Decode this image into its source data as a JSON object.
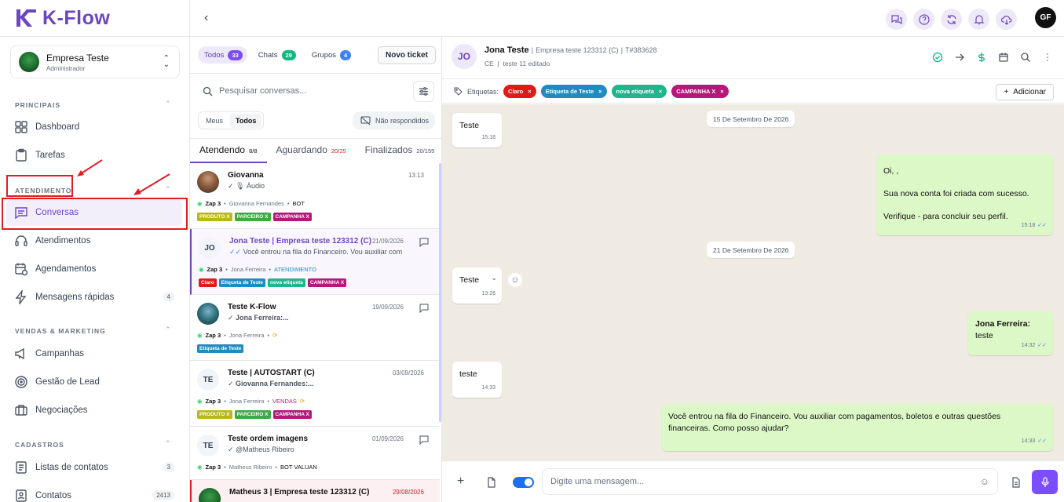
{
  "brand": {
    "name": "K-Flow",
    "color": "#6b46c1"
  },
  "company": {
    "name": "Empresa Teste",
    "role": "Administrador"
  },
  "sidebar": {
    "sections": [
      {
        "title": "PRINCIPAIS",
        "items": [
          {
            "label": "Dashboard",
            "icon": "dashboard-icon"
          },
          {
            "label": "Tarefas",
            "icon": "clipboard-icon"
          }
        ]
      },
      {
        "title": "ATENDIMENTO",
        "items": [
          {
            "label": "Conversas",
            "icon": "chat-icon",
            "active": true
          },
          {
            "label": "Atendimentos",
            "icon": "headset-icon"
          },
          {
            "label": "Agendamentos",
            "icon": "calendar-clock-icon"
          },
          {
            "label": "Mensagens rápidas",
            "icon": "bolt-icon",
            "badge": "4"
          }
        ]
      },
      {
        "title": "VENDAS & MARKETING",
        "items": [
          {
            "label": "Campanhas",
            "icon": "megaphone-icon"
          },
          {
            "label": "Gestão de Lead",
            "icon": "target-icon"
          },
          {
            "label": "Negociações",
            "icon": "briefcase-icon"
          }
        ]
      },
      {
        "title": "CADASTROS",
        "items": [
          {
            "label": "Listas de contatos",
            "icon": "list-icon",
            "badge": "3"
          },
          {
            "label": "Contatos",
            "icon": "contact-icon",
            "badge": "2413"
          }
        ]
      }
    ]
  },
  "topbar": {
    "user_initials": "GF"
  },
  "filters": {
    "tabs": [
      {
        "label": "Todos",
        "count": "33",
        "color": "#7c4dff"
      },
      {
        "label": "Chats",
        "count": "29",
        "color": "#10b981"
      },
      {
        "label": "Grupos",
        "count": "4",
        "color": "#3b82f6"
      }
    ],
    "new_ticket": "Novo ticket",
    "search_placeholder": "Pesquisar conversas...",
    "seg": [
      "Meus",
      "Todos"
    ],
    "unanswered": "Não respondidos",
    "status_tabs": [
      {
        "label": "Atendendo",
        "count": "8/8"
      },
      {
        "label": "Aguardando",
        "count": "20/25"
      },
      {
        "label": "Finalizados",
        "count": "20/155"
      }
    ]
  },
  "conversations": [
    {
      "initials": "",
      "name": "Giovanna",
      "date": "13:13",
      "msg": "Áudio",
      "meta_zap": "Zap 3",
      "meta_agent": "Giovanna Fernandes",
      "meta_status": "BOT",
      "tags": [
        [
          "PRODUTO X",
          "#b8b81a"
        ],
        [
          "PARCEIRO X",
          "#3fa847"
        ],
        [
          "CAMPANHA X",
          "#b5177a"
        ]
      ]
    },
    {
      "initials": "JO",
      "name": "Jona Teste | Empresa teste 123312 (C)",
      "date": "21/09/2026",
      "msg": "Você entrou na fila do Financeiro. Vou auxiliar com p...",
      "meta_zap": "Zap 3",
      "meta_agent": "Jona Ferreira",
      "meta_status": "ATENDIMENTO",
      "tags": [
        [
          "Claro",
          "#e01919"
        ],
        [
          "Etiqueta de Teste",
          "#1f8bbf"
        ],
        [
          "nova etiqueta",
          "#21b58c"
        ],
        [
          "CAMPANHA X",
          "#b5177a"
        ]
      ]
    },
    {
      "initials": "",
      "name": "Teste K-Flow",
      "date": "19/09/2026",
      "msg": "Jona Ferreira:...",
      "meta_zap": "Zap 3",
      "meta_agent": "Jona Ferreira",
      "meta_status": "",
      "tags": [
        [
          "Etiqueta de Teste",
          "#1f8bbf"
        ]
      ]
    },
    {
      "initials": "TE",
      "name": "Teste | AUTOSTART (C)",
      "date": "03/09/2026",
      "msg": "Giovanna Fernandes:...",
      "meta_zap": "Zap 3",
      "meta_agent": "Jona Ferreira",
      "meta_status": "VENDAS",
      "tags": [
        [
          "PRODUTO X",
          "#b8b81a"
        ],
        [
          "PARCEIRO X",
          "#3fa847"
        ],
        [
          "CAMPANHA X",
          "#b5177a"
        ]
      ]
    },
    {
      "initials": "TE",
      "name": "Teste ordem imagens",
      "date": "01/09/2026",
      "msg": "@Matheus Ribeiro",
      "meta_zap": "Zap 3",
      "meta_agent": "Matheus Ribeiro",
      "meta_status": "BOT VALUAN",
      "tags": []
    },
    {
      "initials": "",
      "name": "Matheus 3 | Empresa teste 123312 (C)",
      "date": "29/08/2026",
      "msg": "",
      "meta_zap": "",
      "meta_agent": "",
      "meta_status": "",
      "tags": []
    }
  ],
  "chat": {
    "initials": "JO",
    "name": "Jona Teste",
    "company": "Empresa teste 123312 (C)",
    "ticket": "T#383628",
    "sub1": "CE",
    "sub2": "teste 11 editado",
    "labels_title": "Etiquetas:",
    "labels": [
      [
        "Claro",
        "#e01919"
      ],
      [
        "Etiqueta de Teste",
        "#1f8bbf"
      ],
      [
        "nova etiqueta",
        "#21b58c"
      ],
      [
        "CAMPANHA X",
        "#b5177a"
      ]
    ],
    "add_label": "Adicionar",
    "dates": [
      "15 De Setembro De 2026",
      "21 De Setembro De 2026"
    ],
    "messages": [
      {
        "text": "Teste",
        "time": "15:18"
      },
      {
        "l1": "Oi, ,",
        "l2": "Sua nova conta foi criada com sucesso.",
        "l3": "Verifique - para concluir seu perfil.",
        "time": "15:18"
      },
      {
        "text": "Teste",
        "time": "13:26"
      },
      {
        "sender": "Jona Ferreira:",
        "text": "teste",
        "time": "14:32"
      },
      {
        "text": "teste",
        "time": "14:33"
      },
      {
        "l1": "Você entrou na fila do Financeiro. Vou auxiliar com pagamentos, boletos e outras questões",
        "l2": "financeiras. Como posso ajudar?",
        "time": "14:33"
      }
    ],
    "input_placeholder": "Digite uma mensagem..."
  }
}
